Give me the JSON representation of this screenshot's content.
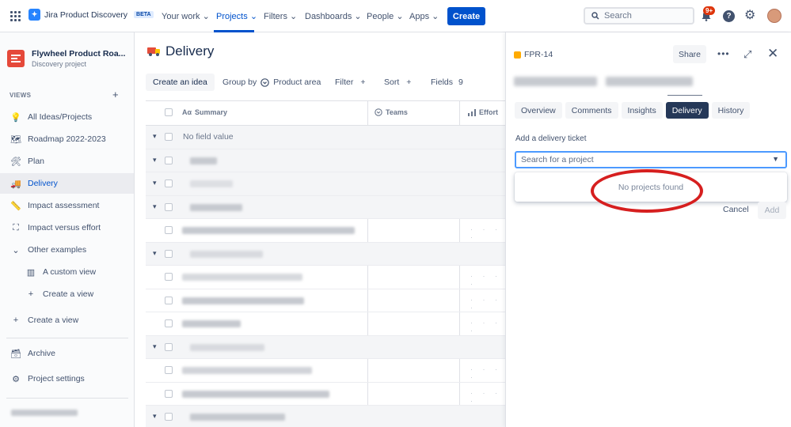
{
  "topnav": {
    "product_name": "Jira Product Discovery",
    "beta_label": "BETA",
    "items": [
      {
        "label": "Your work"
      },
      {
        "label": "Projects"
      },
      {
        "label": "Filters"
      },
      {
        "label": "Dashboards"
      },
      {
        "label": "People"
      },
      {
        "label": "Apps"
      }
    ],
    "create_label": "Create",
    "search_placeholder": "Search",
    "notification_count": "9+"
  },
  "sidebar": {
    "project_name": "Flywheel Product Roa...",
    "project_type": "Discovery project",
    "views_label": "VIEWS",
    "views_add": "+",
    "items": [
      {
        "icon": "lightbulb-icon",
        "glyph": "💡",
        "label": "All Ideas/Projects"
      },
      {
        "icon": "map-icon",
        "glyph": "🗺",
        "label": "Roadmap 2022-2023"
      },
      {
        "icon": "tools-icon",
        "glyph": "🛠",
        "label": "Plan"
      },
      {
        "icon": "truck-icon",
        "glyph": "🚚",
        "label": "Delivery"
      },
      {
        "icon": "ruler-icon",
        "glyph": "📏",
        "label": "Impact assessment"
      },
      {
        "icon": "scatter-chart-icon",
        "glyph": "⛶",
        "label": "Impact versus effort"
      },
      {
        "icon": "chevron-down-icon",
        "glyph": "⌄",
        "label": "Other examples"
      },
      {
        "icon": "board-icon",
        "glyph": "▥",
        "label": "A custom view"
      },
      {
        "icon": "plus-icon",
        "glyph": "+",
        "label": "Create a view"
      },
      {
        "icon": "plus-icon",
        "glyph": "+",
        "label": "Create a view"
      },
      {
        "icon": "archive-icon",
        "glyph": "🗃",
        "label": "Archive"
      },
      {
        "icon": "gear-icon",
        "glyph": "⚙",
        "label": "Project settings"
      }
    ]
  },
  "main": {
    "title": "Delivery",
    "toolbar": {
      "create_idea": "Create an idea",
      "group_by": "Group by",
      "group_value": "Product area",
      "filter": "Filter",
      "sort": "Sort",
      "fields": "Fields",
      "fields_count": "9"
    },
    "columns": {
      "summary": "Summary",
      "summary_prefix": "Aα",
      "teams": "Teams",
      "effort": "Effort"
    },
    "no_field_value": "No field value",
    "row_dots": "· · · ·"
  },
  "panel": {
    "issue_key": "FPR-14",
    "share_label": "Share",
    "tabs": [
      {
        "label": "Overview"
      },
      {
        "label": "Comments"
      },
      {
        "label": "Insights"
      },
      {
        "label": "Delivery"
      },
      {
        "label": "History"
      }
    ],
    "active_tab": "Delivery",
    "add_ticket_label": "Add a delivery ticket",
    "search_project_placeholder": "Search for a project",
    "no_projects": "No projects found",
    "cancel_label": "Cancel",
    "add_label": "Add"
  },
  "colors": {
    "brand": "#0052cc",
    "active_tab": "#253858",
    "annotation": "#d61f1f",
    "badge": "#de350b"
  }
}
